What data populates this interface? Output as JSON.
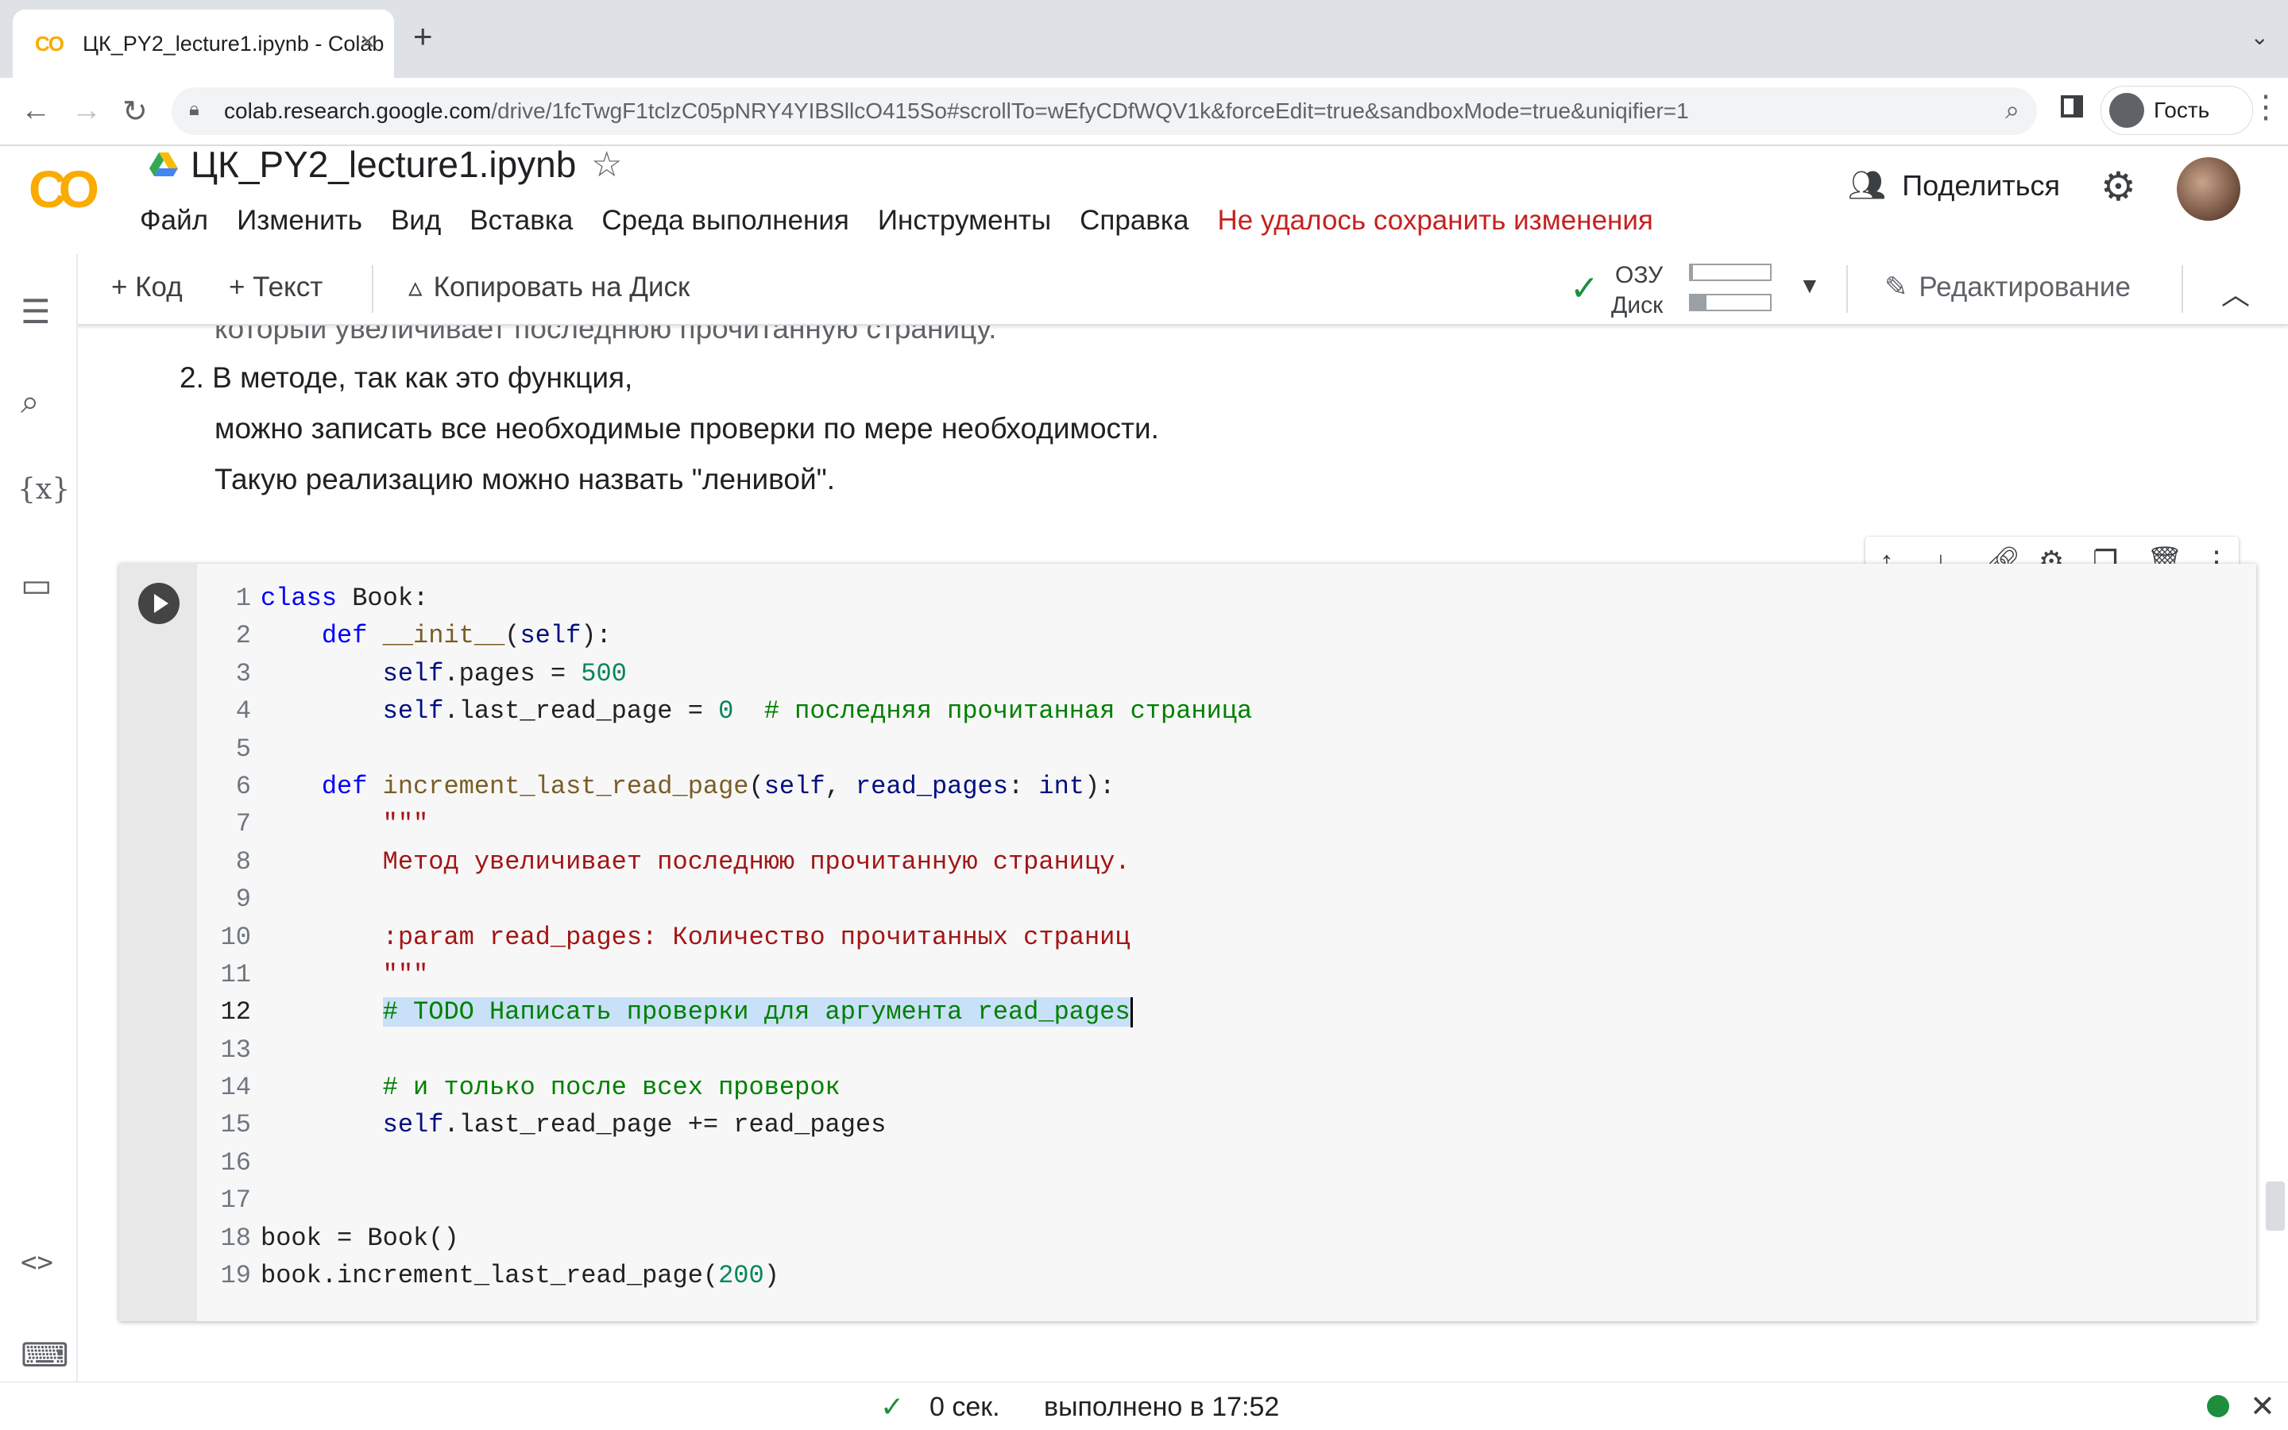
{
  "browser": {
    "tab_title": "ЦК_PY2_lecture1.ipynb - Colab",
    "favicon": "CO",
    "url_host": "colab.research.google.com",
    "url_path": "/drive/1fcTwgF1tclzC05pNRY4YIBSllcO415So#scrollTo=wEfyCDfWQV1k&forceEdit=true&sandboxMode=true&uniqifier=1",
    "profile_label": "Гость"
  },
  "colab": {
    "logo": "CO",
    "notebook_title": "ЦК_PY2_lecture1.ipynb",
    "menu": [
      "Файл",
      "Изменить",
      "Вид",
      "Вставка",
      "Среда выполнения",
      "Инструменты",
      "Справка"
    ],
    "save_error": "Не удалось сохранить изменения",
    "share_label": "Поделиться"
  },
  "toolbar": {
    "add_code": "+ Код",
    "add_text": "+ Текст",
    "copy_to_drive": "Копировать на Диск",
    "ram_label": "ОЗУ",
    "disk_label": "Диск",
    "ram_usage": 0.03,
    "disk_usage": 0.2,
    "editing_label": "Редактирование"
  },
  "text_cell": {
    "cut_line": "который увеличивает последнюю прочитанную страницу.",
    "item_number": "2.",
    "lines": [
      "В методе, так как это функция,",
      "можно записать все необходимые проверки по мере необходимости.",
      "Такую реализацию можно назвать \"ленивой\"."
    ]
  },
  "code_cell": {
    "active_line": 12,
    "lines": [
      [
        {
          "t": "class ",
          "c": "kw"
        },
        {
          "t": "Book:",
          "c": ""
        }
      ],
      [
        {
          "t": "    ",
          "c": ""
        },
        {
          "t": "def ",
          "c": "kw"
        },
        {
          "t": "__init__",
          "c": "fn"
        },
        {
          "t": "(",
          "c": ""
        },
        {
          "t": "self",
          "c": "self"
        },
        {
          "t": "):",
          "c": ""
        }
      ],
      [
        {
          "t": "        ",
          "c": ""
        },
        {
          "t": "self",
          "c": "self"
        },
        {
          "t": ".pages = ",
          "c": ""
        },
        {
          "t": "500",
          "c": "num"
        }
      ],
      [
        {
          "t": "        ",
          "c": ""
        },
        {
          "t": "self",
          "c": "self"
        },
        {
          "t": ".last_read_page = ",
          "c": ""
        },
        {
          "t": "0",
          "c": "num"
        },
        {
          "t": "  # последняя прочитанная страница",
          "c": "com"
        }
      ],
      [
        {
          "t": "",
          "c": ""
        }
      ],
      [
        {
          "t": "    ",
          "c": ""
        },
        {
          "t": "def ",
          "c": "kw"
        },
        {
          "t": "increment_last_read_page",
          "c": "fn"
        },
        {
          "t": "(",
          "c": ""
        },
        {
          "t": "self",
          "c": "self"
        },
        {
          "t": ", ",
          "c": ""
        },
        {
          "t": "read_pages",
          "c": "self"
        },
        {
          "t": ": ",
          "c": ""
        },
        {
          "t": "int",
          "c": "self"
        },
        {
          "t": "):",
          "c": ""
        }
      ],
      [
        {
          "t": "        ",
          "c": ""
        },
        {
          "t": "\"\"\"",
          "c": "str"
        }
      ],
      [
        {
          "t": "        ",
          "c": ""
        },
        {
          "t": "Метод увеличивает последнюю прочитанную страницу.",
          "c": "str"
        }
      ],
      [
        {
          "t": "",
          "c": ""
        }
      ],
      [
        {
          "t": "        ",
          "c": ""
        },
        {
          "t": ":param read_pages: Количество прочитанных страниц",
          "c": "str"
        }
      ],
      [
        {
          "t": "        ",
          "c": ""
        },
        {
          "t": "\"\"\"",
          "c": "str"
        }
      ],
      [
        {
          "t": "        ",
          "c": ""
        },
        {
          "t": "# TODO Написать проверки для аргумента read_pages",
          "c": "com sel"
        }
      ],
      [
        {
          "t": "",
          "c": ""
        }
      ],
      [
        {
          "t": "        ",
          "c": ""
        },
        {
          "t": "# и только после всех проверок",
          "c": "com"
        }
      ],
      [
        {
          "t": "        ",
          "c": ""
        },
        {
          "t": "self",
          "c": "self"
        },
        {
          "t": ".last_read_page += read_pages",
          "c": ""
        }
      ],
      [
        {
          "t": "",
          "c": ""
        }
      ],
      [
        {
          "t": "",
          "c": ""
        }
      ],
      [
        {
          "t": "book = Book()",
          "c": ""
        }
      ],
      [
        {
          "t": "book.increment_last_read_page(",
          "c": ""
        },
        {
          "t": "200",
          "c": "num"
        },
        {
          "t": ")",
          "c": ""
        }
      ]
    ]
  },
  "status": {
    "duration": "0 сек.",
    "completed": "выполнено в 17:52"
  },
  "colors": {
    "accent_orange": "#f9ab00",
    "error_red": "#c5221f",
    "ok_green": "#1e8e3e"
  }
}
